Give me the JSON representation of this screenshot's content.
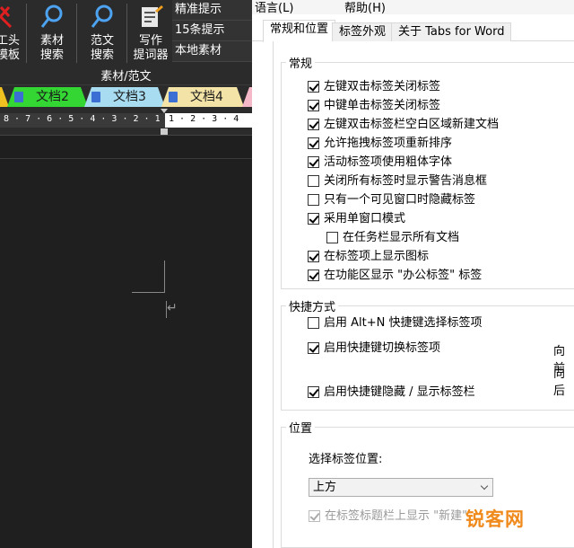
{
  "ribbon": {
    "buttons": [
      {
        "label1": "工头",
        "label2": "模板",
        "icon": "ribbon-red-icon"
      },
      {
        "label1": "素材",
        "label2": "搜索",
        "icon": "search-icon"
      },
      {
        "label1": "范文",
        "label2": "搜索",
        "icon": "search-icon"
      },
      {
        "label1": "写作",
        "label2": "提词器",
        "icon": "writing-icon"
      }
    ],
    "side_items": [
      "精准提示",
      "15条提示",
      "本地素材"
    ],
    "group_label": "素材/范文"
  },
  "doc_tabs": [
    {
      "label": "文档2",
      "color": "#33d633"
    },
    {
      "label": "文档3",
      "color": "#a8dcf0"
    },
    {
      "label": "文档4",
      "color": "#f3e3a6"
    }
  ],
  "ruler": {
    "left_ticks": "8 · 7 · 6 · 5 · 4 · 3 · 2 · 1",
    "right_ticks": "1 · 2 · 3 · 4"
  },
  "dialog": {
    "menu": {
      "language": "语言(L)",
      "help": "帮助(H)"
    },
    "tabs": [
      "常规和位置",
      "标签外观",
      "关于 Tabs for Word"
    ],
    "general": {
      "title": "常规",
      "options": [
        {
          "label": "左键双击标签关闭标签",
          "checked": true
        },
        {
          "label": "中键单击标签关闭标签",
          "checked": true
        },
        {
          "label": "左键双击标签栏空白区域新建文档",
          "checked": true
        },
        {
          "label": "允许拖拽标签项重新排序",
          "checked": true
        },
        {
          "label": "活动标签项使用粗体字体",
          "checked": true
        },
        {
          "label": "关闭所有标签时显示警告消息框",
          "checked": false
        },
        {
          "label": "只有一个可见窗口时隐藏标签",
          "checked": false
        },
        {
          "label": "采用单窗口模式",
          "checked": true
        },
        {
          "label": "在任务栏显示所有文档",
          "checked": false
        },
        {
          "label": "在标签项上显示图标",
          "checked": true
        },
        {
          "label": "在功能区显示 \"办公标签\" 标签",
          "checked": true
        }
      ]
    },
    "shortcuts": {
      "title": "快捷方式",
      "options": [
        {
          "label": "启用 Alt+N 快捷键选择标签项",
          "checked": false
        },
        {
          "label": "启用快捷键切换标签项",
          "checked": true
        },
        {
          "label": "启用快捷键隐藏 / 显示标签栏",
          "checked": true
        }
      ],
      "side_labels": [
        "向前",
        "向后"
      ]
    },
    "position": {
      "title": "位置",
      "select_label": "选择标签位置:",
      "select_value": "上方",
      "new_button_option": {
        "label": "在标签标题栏上显示 \"新建\"",
        "checked": true,
        "disabled": true
      }
    }
  },
  "watermark": "锐客网"
}
